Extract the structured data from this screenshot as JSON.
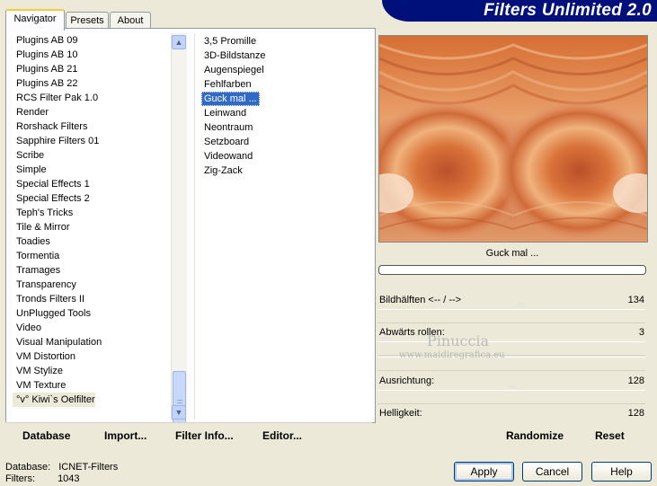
{
  "app_title": "Filters Unlimited 2.0",
  "tabs": [
    {
      "label": "Navigator",
      "active": true
    },
    {
      "label": "Presets",
      "active": false
    },
    {
      "label": "About",
      "active": false
    }
  ],
  "categories": [
    "Plugins AB 09",
    "Plugins AB 10",
    "Plugins AB 21",
    "Plugins AB 22",
    "RCS Filter Pak 1.0",
    "Render",
    "Rorshack Filters",
    "Sapphire Filters 01",
    "Scribe",
    "Simple",
    "Special Effects 1",
    "Special Effects 2",
    "Teph's Tricks",
    "Tile & Mirror",
    "Toadies",
    "Tormentia",
    "Tramages",
    "Transparency",
    "Tronds Filters II",
    "UnPlugged Tools",
    "Video",
    "Visual Manipulation",
    "VM Distortion",
    "VM Stylize",
    "VM Texture",
    "°v° Kiwi`s Oelfilter"
  ],
  "selected_category": "°v° Kiwi`s Oelfilter",
  "filters": [
    "3,5 Promille",
    "3D-Bildstanze",
    "Augenspiegel",
    "Fehlfarben",
    "Guck mal ...",
    "Leinwand",
    "Neontraum",
    "Setzboard",
    "Videowand",
    "Zig-Zack"
  ],
  "selected_filter": "Guck mal ...",
  "toolbar": {
    "database": "Database",
    "import": "Import...",
    "filter_info": "Filter Info...",
    "editor": "Editor..."
  },
  "preview": {
    "filter_name": "Guck mal ..."
  },
  "params": [
    {
      "label": "Bildhälften <-- / -->",
      "value": "134"
    },
    {
      "label": "Abwärts rollen:",
      "value": "3"
    },
    {
      "label": "Ausrichtung:",
      "value": "128"
    },
    {
      "label": "Helligkeit:",
      "value": "128"
    }
  ],
  "watermark": {
    "line1": "Pinuccia",
    "line2": "www.maidiregrafica.eu"
  },
  "actions": {
    "randomize": "Randomize",
    "reset": "Reset"
  },
  "buttons": {
    "apply": "Apply",
    "cancel": "Cancel",
    "help": "Help"
  },
  "status": {
    "database_label": "Database:",
    "database_value": "ICNET-Filters",
    "filters_label": "Filters:",
    "filters_value": "1043"
  },
  "colors": {
    "banner": "#00107a",
    "selection": "#316ac5",
    "preview_main": "#d9733a"
  }
}
